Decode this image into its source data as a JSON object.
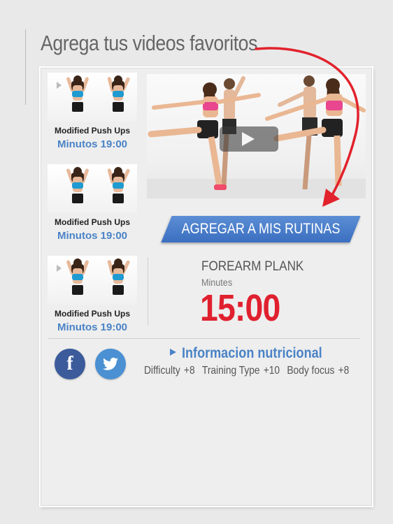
{
  "header": {
    "title": "Agrega tus videos favoritos"
  },
  "thumbnails": [
    {
      "title": "Modified Push Ups",
      "duration": "Minutos 19:00"
    },
    {
      "title": "Modified Push Ups",
      "duration": "Minutos 19:00"
    },
    {
      "title": "Modified Push Ups",
      "duration": "Minutos 19:00"
    }
  ],
  "video": {
    "play_icon": "play-icon"
  },
  "add_button": {
    "label": "AGREGAR A MIS RUTINAS"
  },
  "exercise": {
    "name": "FOREARM PLANK",
    "unit": "Minutes",
    "time": "15:00"
  },
  "social": {
    "facebook_icon": "facebook-icon",
    "twitter_icon": "twitter-icon",
    "facebook_glyph": "f"
  },
  "nutrition": {
    "label": "Informacion nutricional"
  },
  "stats": [
    {
      "label": "Difficulty",
      "value": "+8"
    },
    {
      "label": "Training Type",
      "value": "+10"
    },
    {
      "label": "Body focus",
      "value": "+8"
    }
  ],
  "colors": {
    "accent_blue": "#4a83c6",
    "time_red": "#e0202f",
    "facebook": "#3b5b9b",
    "twitter": "#4a90d2"
  }
}
